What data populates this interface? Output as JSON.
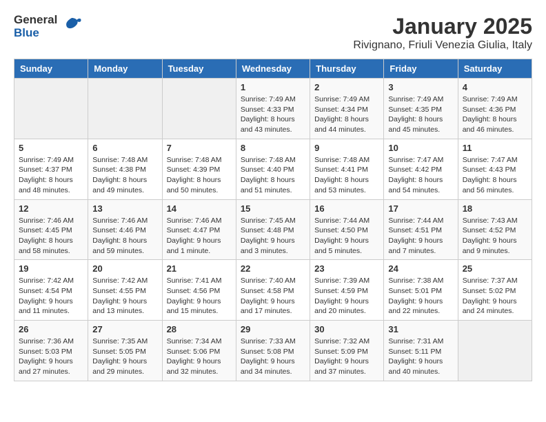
{
  "header": {
    "logo": {
      "general": "General",
      "blue": "Blue"
    },
    "title": "January 2025",
    "location": "Rivignano, Friuli Venezia Giulia, Italy"
  },
  "calendar": {
    "weekdays": [
      "Sunday",
      "Monday",
      "Tuesday",
      "Wednesday",
      "Thursday",
      "Friday",
      "Saturday"
    ],
    "weeks": [
      [
        {
          "day": "",
          "info": ""
        },
        {
          "day": "",
          "info": ""
        },
        {
          "day": "",
          "info": ""
        },
        {
          "day": "1",
          "info": "Sunrise: 7:49 AM\nSunset: 4:33 PM\nDaylight: 8 hours and 43 minutes."
        },
        {
          "day": "2",
          "info": "Sunrise: 7:49 AM\nSunset: 4:34 PM\nDaylight: 8 hours and 44 minutes."
        },
        {
          "day": "3",
          "info": "Sunrise: 7:49 AM\nSunset: 4:35 PM\nDaylight: 8 hours and 45 minutes."
        },
        {
          "day": "4",
          "info": "Sunrise: 7:49 AM\nSunset: 4:36 PM\nDaylight: 8 hours and 46 minutes."
        }
      ],
      [
        {
          "day": "5",
          "info": "Sunrise: 7:49 AM\nSunset: 4:37 PM\nDaylight: 8 hours and 48 minutes."
        },
        {
          "day": "6",
          "info": "Sunrise: 7:48 AM\nSunset: 4:38 PM\nDaylight: 8 hours and 49 minutes."
        },
        {
          "day": "7",
          "info": "Sunrise: 7:48 AM\nSunset: 4:39 PM\nDaylight: 8 hours and 50 minutes."
        },
        {
          "day": "8",
          "info": "Sunrise: 7:48 AM\nSunset: 4:40 PM\nDaylight: 8 hours and 51 minutes."
        },
        {
          "day": "9",
          "info": "Sunrise: 7:48 AM\nSunset: 4:41 PM\nDaylight: 8 hours and 53 minutes."
        },
        {
          "day": "10",
          "info": "Sunrise: 7:47 AM\nSunset: 4:42 PM\nDaylight: 8 hours and 54 minutes."
        },
        {
          "day": "11",
          "info": "Sunrise: 7:47 AM\nSunset: 4:43 PM\nDaylight: 8 hours and 56 minutes."
        }
      ],
      [
        {
          "day": "12",
          "info": "Sunrise: 7:46 AM\nSunset: 4:45 PM\nDaylight: 8 hours and 58 minutes."
        },
        {
          "day": "13",
          "info": "Sunrise: 7:46 AM\nSunset: 4:46 PM\nDaylight: 8 hours and 59 minutes."
        },
        {
          "day": "14",
          "info": "Sunrise: 7:46 AM\nSunset: 4:47 PM\nDaylight: 9 hours and 1 minute."
        },
        {
          "day": "15",
          "info": "Sunrise: 7:45 AM\nSunset: 4:48 PM\nDaylight: 9 hours and 3 minutes."
        },
        {
          "day": "16",
          "info": "Sunrise: 7:44 AM\nSunset: 4:50 PM\nDaylight: 9 hours and 5 minutes."
        },
        {
          "day": "17",
          "info": "Sunrise: 7:44 AM\nSunset: 4:51 PM\nDaylight: 9 hours and 7 minutes."
        },
        {
          "day": "18",
          "info": "Sunrise: 7:43 AM\nSunset: 4:52 PM\nDaylight: 9 hours and 9 minutes."
        }
      ],
      [
        {
          "day": "19",
          "info": "Sunrise: 7:42 AM\nSunset: 4:54 PM\nDaylight: 9 hours and 11 minutes."
        },
        {
          "day": "20",
          "info": "Sunrise: 7:42 AM\nSunset: 4:55 PM\nDaylight: 9 hours and 13 minutes."
        },
        {
          "day": "21",
          "info": "Sunrise: 7:41 AM\nSunset: 4:56 PM\nDaylight: 9 hours and 15 minutes."
        },
        {
          "day": "22",
          "info": "Sunrise: 7:40 AM\nSunset: 4:58 PM\nDaylight: 9 hours and 17 minutes."
        },
        {
          "day": "23",
          "info": "Sunrise: 7:39 AM\nSunset: 4:59 PM\nDaylight: 9 hours and 20 minutes."
        },
        {
          "day": "24",
          "info": "Sunrise: 7:38 AM\nSunset: 5:01 PM\nDaylight: 9 hours and 22 minutes."
        },
        {
          "day": "25",
          "info": "Sunrise: 7:37 AM\nSunset: 5:02 PM\nDaylight: 9 hours and 24 minutes."
        }
      ],
      [
        {
          "day": "26",
          "info": "Sunrise: 7:36 AM\nSunset: 5:03 PM\nDaylight: 9 hours and 27 minutes."
        },
        {
          "day": "27",
          "info": "Sunrise: 7:35 AM\nSunset: 5:05 PM\nDaylight: 9 hours and 29 minutes."
        },
        {
          "day": "28",
          "info": "Sunrise: 7:34 AM\nSunset: 5:06 PM\nDaylight: 9 hours and 32 minutes."
        },
        {
          "day": "29",
          "info": "Sunrise: 7:33 AM\nSunset: 5:08 PM\nDaylight: 9 hours and 34 minutes."
        },
        {
          "day": "30",
          "info": "Sunrise: 7:32 AM\nSunset: 5:09 PM\nDaylight: 9 hours and 37 minutes."
        },
        {
          "day": "31",
          "info": "Sunrise: 7:31 AM\nSunset: 5:11 PM\nDaylight: 9 hours and 40 minutes."
        },
        {
          "day": "",
          "info": ""
        }
      ]
    ]
  }
}
